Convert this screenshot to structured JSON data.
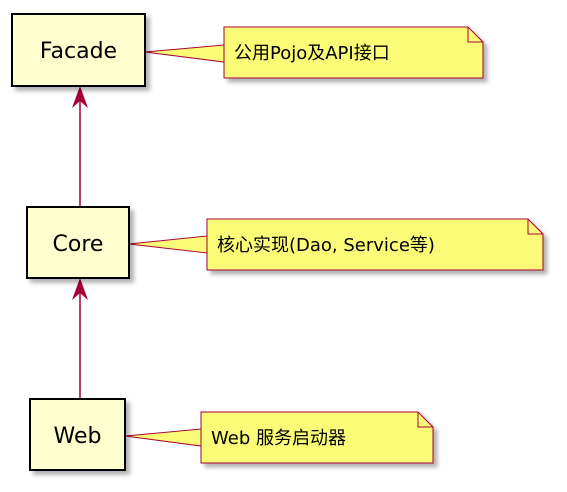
{
  "colors": {
    "box_fill": "#FEFECE",
    "box_border": "#000000",
    "note_fill": "#FBFB77",
    "note_border": "#A80036",
    "arrow": "#A80036",
    "shadow": "#C8C8C8"
  },
  "components": [
    {
      "id": "facade",
      "label": "Facade"
    },
    {
      "id": "core",
      "label": "Core"
    },
    {
      "id": "web",
      "label": "Web"
    }
  ],
  "notes": [
    {
      "target": "facade",
      "text": "公用Pojo及API接口"
    },
    {
      "target": "core",
      "text": "核心实现(Dao, Service等)"
    },
    {
      "target": "web",
      "text": "Web 服务启动器"
    }
  ],
  "dependencies": [
    {
      "from": "core",
      "to": "facade"
    },
    {
      "from": "web",
      "to": "core"
    }
  ]
}
